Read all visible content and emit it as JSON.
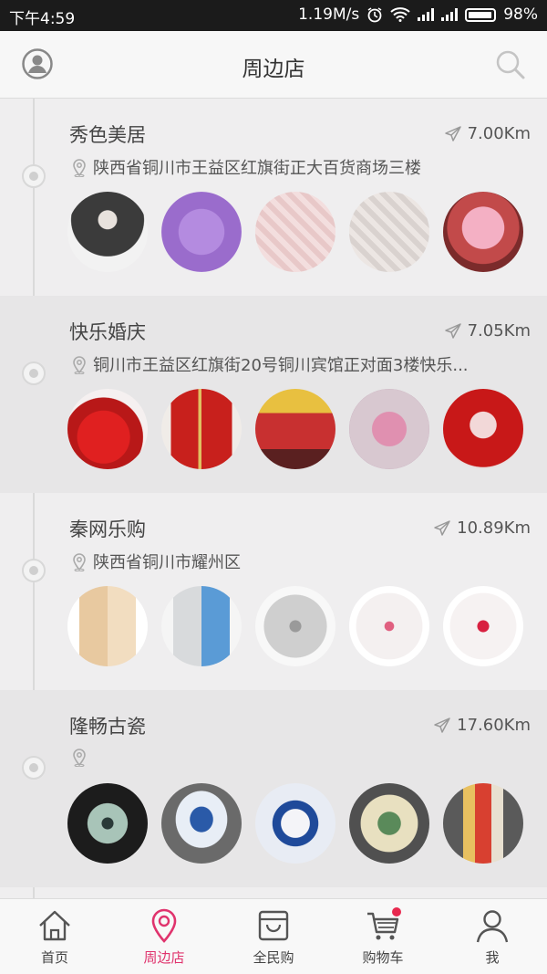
{
  "status_bar": {
    "time": "下午4:59",
    "speed": "1.19M/s",
    "battery": "98%"
  },
  "header": {
    "title": "周边店"
  },
  "stores": [
    {
      "name": "秀色美居",
      "distance": "7.00Km",
      "address": "陕西省铜川市王益区红旗街正大百货商场三楼",
      "thumbs": [
        "thermal-underwear-model",
        "purple-fleece-pajamas",
        "pink-plaid-pajamas",
        "grey-plaid-pajamas",
        "red-kids-pajamas"
      ]
    },
    {
      "name": "快乐婚庆",
      "distance": "7.05Km",
      "address": "铜川市王益区红旗街20号铜川宾馆正对面3楼快乐...",
      "thumbs": [
        "red-wedding-towels",
        "red-gift-tins",
        "red-bowls-with-flowers",
        "wedding-backdrop",
        "red-wedding-decor"
      ]
    },
    {
      "name": "秦网乐购",
      "distance": "10.89Km",
      "address": "陕西省铜川市耀州区",
      "thumbs": [
        "gold-iphone",
        "silver-iphone",
        "silver-rice-cooker",
        "floral-rice-cooker",
        "red-floral-rice-cooker"
      ]
    },
    {
      "name": "隆畅古瓷",
      "distance": "17.60Km",
      "address": "",
      "thumbs": [
        "celadon-vase",
        "blue-white-jar",
        "blue-white-plate",
        "famille-rose-pot",
        "rooster-vase"
      ]
    }
  ],
  "tabs": [
    {
      "label": "首页",
      "icon": "home-icon",
      "active": false
    },
    {
      "label": "周边店",
      "icon": "location-pin-icon",
      "active": true
    },
    {
      "label": "全民购",
      "icon": "shopping-bag-icon",
      "active": false
    },
    {
      "label": "购物车",
      "icon": "cart-icon",
      "active": false
    },
    {
      "label": "我",
      "icon": "profile-icon",
      "active": false
    }
  ],
  "colors": {
    "accent": "#e0336d",
    "badge": "#e8294f"
  }
}
